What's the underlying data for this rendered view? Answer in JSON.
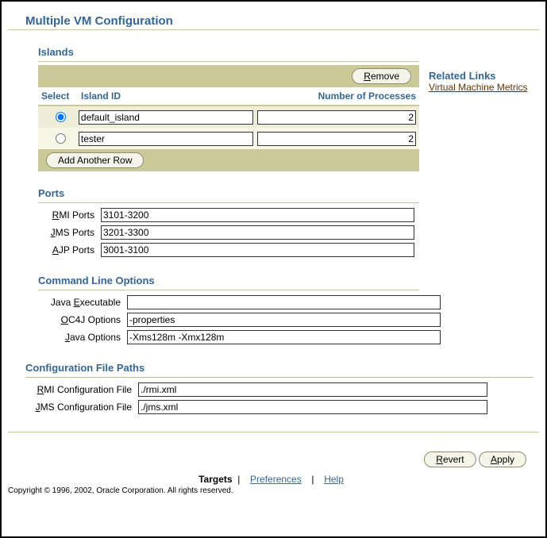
{
  "page_title": "Multiple VM Configuration",
  "islands": {
    "title": "Islands",
    "remove_label": "Remove",
    "add_row_label": "Add Another Row",
    "headers": {
      "select": "Select",
      "island_id": "Island ID",
      "num_proc": "Number of Processes"
    },
    "rows": [
      {
        "selected": true,
        "island_id": "default_island",
        "num_processes": "2"
      },
      {
        "selected": false,
        "island_id": "tester",
        "num_processes": "2"
      }
    ]
  },
  "related": {
    "title": "Related Links",
    "vm_metrics": "Virtual Machine Metrics"
  },
  "ports": {
    "title": "Ports",
    "rmi_label_prefix": "R",
    "rmi_label_rest": "MI Ports",
    "rmi_value": "3101-3200",
    "jms_label_prefix": "J",
    "jms_label_rest": "MS Ports",
    "jms_value": "3201-3300",
    "ajp_label_prefix": "A",
    "ajp_label_rest": "JP Ports",
    "ajp_value": "3001-3100"
  },
  "cmd": {
    "title": "Command Line Options",
    "java_exe_pre": "Java ",
    "java_exe_key": "E",
    "java_exe_post": "xecutable",
    "java_exe_value": "",
    "oc4j_key": "O",
    "oc4j_post": "C4J Options",
    "oc4j_value": "-properties",
    "java_opts_pre": "",
    "java_opts_key": "J",
    "java_opts_post": "ava Options",
    "java_opts_value": "-Xms128m -Xmx128m"
  },
  "cfg": {
    "title": "Configuration File Paths",
    "rmi_key": "R",
    "rmi_post": "MI Configuration File",
    "rmi_value": "./rmi.xml",
    "jms_key": "J",
    "jms_post": "MS Configuration File",
    "jms_value": "./jms.xml"
  },
  "buttons": {
    "revert": "Revert",
    "apply": "Apply"
  },
  "footer": {
    "targets": "Targets",
    "preferences": "Preferences",
    "help": "Help",
    "copyright": "Copyright © 1996, 2002, Oracle Corporation. All rights reserved."
  }
}
